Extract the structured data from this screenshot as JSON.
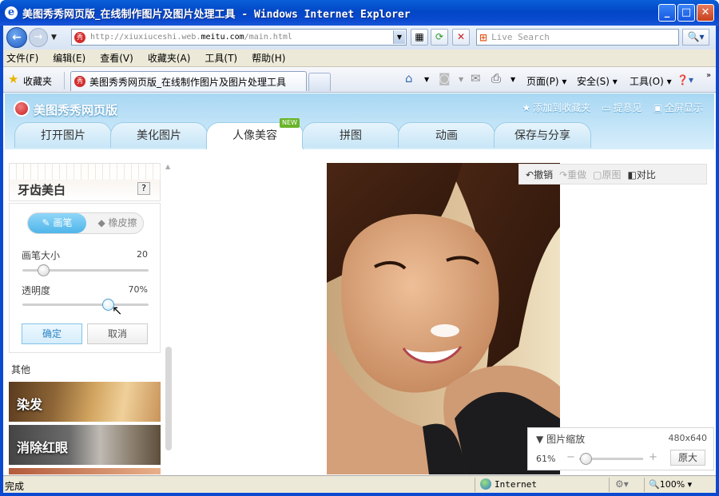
{
  "window": {
    "title_cn": "美图秀秀网页版_在线制作图片及图片处理工具",
    "title_en": " - Windows Internet Explorer",
    "buttons": {
      "minimize": "_",
      "maximize": "□",
      "close": "✕"
    }
  },
  "address": {
    "url_prefix": "http://xiuxiuceshi.web.",
    "url_domain": "meitu.com",
    "url_suffix": "/main.html",
    "search_placeholder": "Live Search"
  },
  "menu": [
    "文件(F)",
    "编辑(E)",
    "查看(V)",
    "收藏夹(A)",
    "工具(T)",
    "帮助(H)"
  ],
  "favorites": {
    "label": "收藏夹"
  },
  "tab": {
    "title": "美图秀秀网页版_在线制作图片及图片处理工具"
  },
  "commands": {
    "page": "页面(P)",
    "safety": "安全(S)",
    "tools": "工具(O)"
  },
  "app": {
    "title": "美图秀秀网页版",
    "links": [
      "添加到收藏夹",
      "提意见",
      "全屏显示"
    ],
    "tabs": [
      "打开图片",
      "美化图片",
      "人像美容",
      "拼图",
      "动画",
      "保存与分享"
    ],
    "active_tab": "人像美容",
    "new_badge": "NEW"
  },
  "panel": {
    "title": "牙齿美白",
    "help": "?",
    "brush": "画笔",
    "eraser": "橡皮擦",
    "brush_size_label": "画笔大小",
    "brush_size_value": "20",
    "brush_size_fraction": 0.13,
    "opacity_label": "透明度",
    "opacity_value": "70%",
    "opacity_fraction": 0.7,
    "confirm": "确定",
    "cancel": "取消",
    "other_label": "其他",
    "features": [
      "染发",
      "消除红眼"
    ]
  },
  "editor": {
    "undo": "撤销",
    "redo": "重做",
    "original": "原图",
    "compare": "对比",
    "zoom_title": "图片缩放",
    "image_size": "480x640",
    "zoom_pct": "61%",
    "zoom_fraction": 0.02,
    "original_size_btn": "原大"
  },
  "status": {
    "done": "完成",
    "zone": "Internet",
    "zoom": "100%"
  }
}
